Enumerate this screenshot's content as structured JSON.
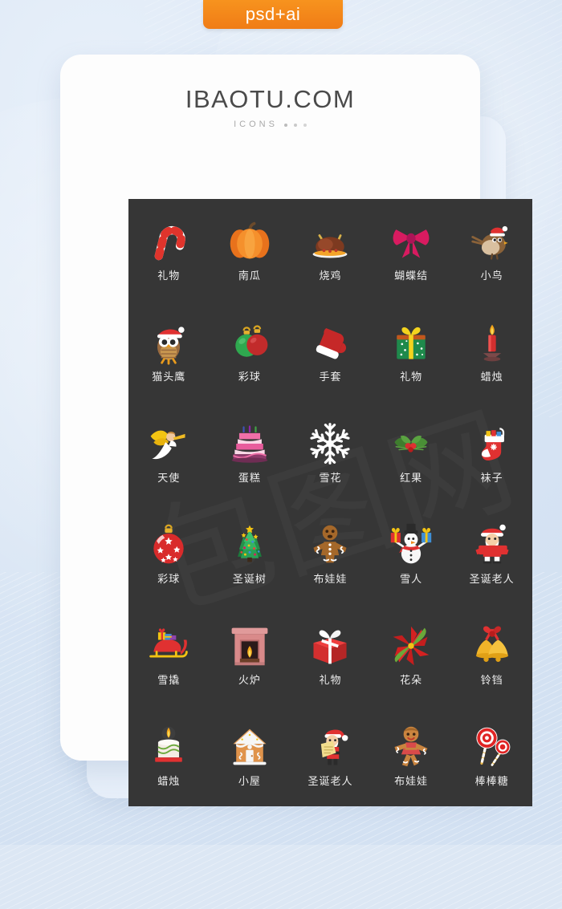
{
  "badge": {
    "label": "psd+ai",
    "color": "#f7931e"
  },
  "header": {
    "title": "IBAOTU.COM",
    "subtitle": "ICONS"
  },
  "panel": {
    "background": "#363636",
    "watermark": "包图网",
    "columns": 5,
    "rows": 6,
    "icons": [
      {
        "name": "candy-cane-icon",
        "label": "礼物",
        "color": "#e8453c"
      },
      {
        "name": "pumpkin-icon",
        "label": "南瓜",
        "color": "#f07c16"
      },
      {
        "name": "roast-chicken-icon",
        "label": "烧鸡",
        "color": "#8a3a22"
      },
      {
        "name": "bow-ribbon-icon",
        "label": "蝴蝶结",
        "color": "#d81b60"
      },
      {
        "name": "bird-icon",
        "label": "小鸟",
        "color": "#8d6239"
      },
      {
        "name": "owl-icon",
        "label": "猫头鹰",
        "color": "#9a6b3f"
      },
      {
        "name": "baubles-icon",
        "label": "彩球",
        "color": "#2fa84f"
      },
      {
        "name": "mitten-glove-icon",
        "label": "手套",
        "color": "#c62828"
      },
      {
        "name": "green-gift-icon",
        "label": "礼物",
        "color": "#1f8a4c"
      },
      {
        "name": "candle-icon",
        "label": "蜡烛",
        "color": "#d32f2f"
      },
      {
        "name": "angel-icon",
        "label": "天使",
        "color": "#f2c313"
      },
      {
        "name": "cake-icon",
        "label": "蛋糕",
        "color": "#e86fa8"
      },
      {
        "name": "snowflake-icon",
        "label": "雪花",
        "color": "#ffffff"
      },
      {
        "name": "holly-berry-icon",
        "label": "红果",
        "color": "#3f7d2e"
      },
      {
        "name": "stocking-icon",
        "label": "袜子",
        "color": "#e03131"
      },
      {
        "name": "star-bauble-icon",
        "label": "彩球",
        "color": "#e03131"
      },
      {
        "name": "christmas-tree-icon",
        "label": "圣诞树",
        "color": "#1f7a3c"
      },
      {
        "name": "gingerbread-man-icon",
        "label": "布娃娃",
        "color": "#a5682a"
      },
      {
        "name": "snowman-icon",
        "label": "雪人",
        "color": "#f5f5f5"
      },
      {
        "name": "santa-claus-icon",
        "label": "圣诞老人",
        "color": "#e03131"
      },
      {
        "name": "sleigh-icon",
        "label": "雪撬",
        "color": "#e03131"
      },
      {
        "name": "fireplace-icon",
        "label": "火炉",
        "color": "#d98a8a"
      },
      {
        "name": "red-gift-icon",
        "label": "礼物",
        "color": "#e03131"
      },
      {
        "name": "poinsettia-flower-icon",
        "label": "花朵",
        "color": "#d42121"
      },
      {
        "name": "bells-icon",
        "label": "铃铛",
        "color": "#f0b429"
      },
      {
        "name": "pillar-candle-icon",
        "label": "蜡烛",
        "color": "#f0e9e2"
      },
      {
        "name": "gingerbread-house-icon",
        "label": "小屋",
        "color": "#d98c4a"
      },
      {
        "name": "santa-list-icon",
        "label": "圣诞老人",
        "color": "#e03131"
      },
      {
        "name": "gingerbread-girl-icon",
        "label": "布娃娃",
        "color": "#c9843f"
      },
      {
        "name": "lollipop-icon",
        "label": "棒棒糖",
        "color": "#e02424"
      }
    ]
  }
}
